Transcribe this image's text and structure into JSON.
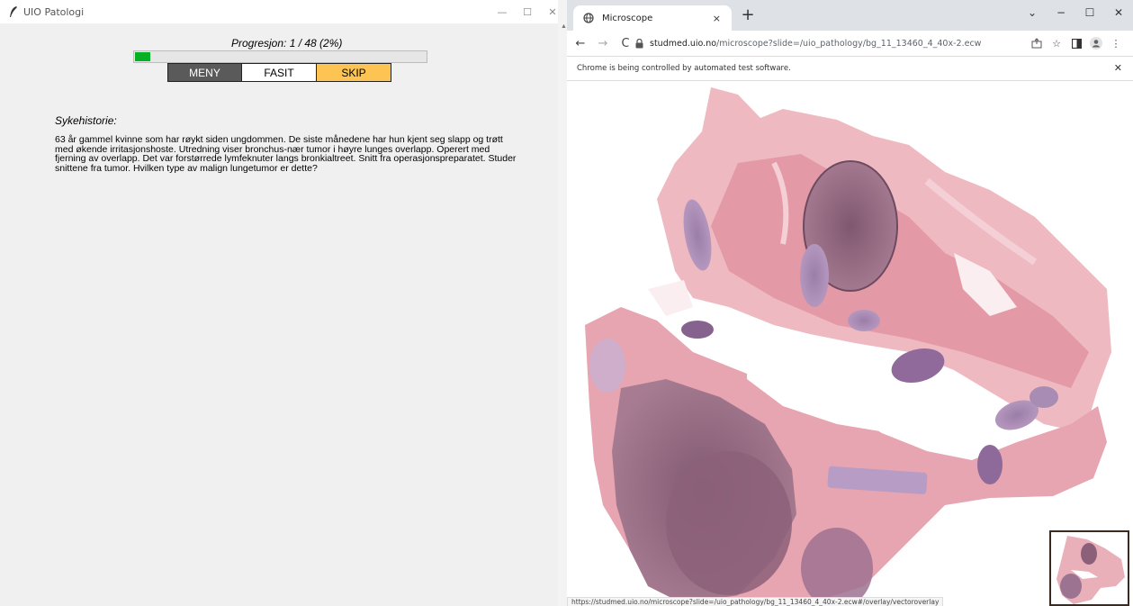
{
  "left_app": {
    "title": "UIO Patologi",
    "controls": {
      "minimize": "—",
      "maximize": "☐",
      "close": "✕"
    },
    "progress": {
      "label": "Progresjon: 1 / 48 (2%)",
      "fraction": 0.02,
      "color": "#06b025"
    },
    "buttons": {
      "menu": "MENY",
      "answer": "FASIT",
      "skip": "SKIP"
    },
    "case": {
      "heading": "Sykehistorie:",
      "text": "63 år gammel kvinne som har røykt siden ungdommen. De siste månedene har hun kjent seg slapp og trøtt med økende irritasjonshoste. Utredning viser bronchus-nær tumor i høyre lunges overlapp. Operert med fjerning av overlapp. Det var forstørrede lymfeknuter langs bronkialtreet. Snitt fra operasjonspreparatet. Studer snittene fra tumor. Hvilken type av malign lungetumor er dette?"
    }
  },
  "browser": {
    "tab": {
      "title": "Microscope",
      "close": "×",
      "icon": "globe-icon"
    },
    "new_tab": "+",
    "window_controls": {
      "dropdown": "⌄",
      "minimize": "−",
      "maximize": "☐",
      "close": "✕"
    },
    "nav": {
      "back": "←",
      "forward": "→",
      "reload": "C"
    },
    "url": {
      "host": "studmed.uio.no",
      "path": "/microscope?slide=/uio_pathology/bg_11_13460_4_40x-2.ecw"
    },
    "toolbar_icons": [
      "share-icon",
      "star-icon",
      "sidepanel-icon",
      "profile-icon",
      "menu-icon"
    ],
    "infobar": {
      "text": "Chrome is being controlled by automated test software.",
      "close": "✕"
    },
    "status_url": "https://studmed.uio.no/microscope?slide=/uio_pathology/bg_11_13460_4_40x-2.ecw#/overlay/vectoroverlay"
  },
  "colors": {
    "tissue_pink": "#e8a3ad",
    "tissue_dark": "#8e6079",
    "tissue_purple": "#a589b0",
    "skip_yellow": "#fdc453",
    "menu_gray": "#5a5a5a"
  }
}
